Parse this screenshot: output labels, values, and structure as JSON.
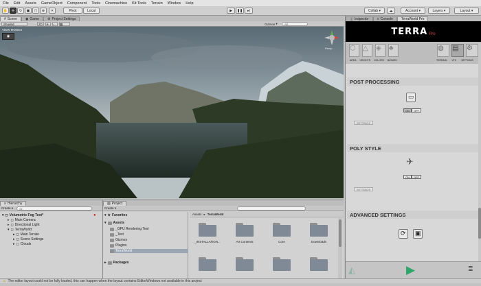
{
  "menu": [
    "File",
    "Edit",
    "Assets",
    "GameObject",
    "Component",
    "Tools",
    "Cinemachine",
    "Kit Tools",
    "Terrain",
    "Window",
    "Help"
  ],
  "toolbar": {
    "pivot": "Pivot",
    "local": "Local",
    "collab": "Collab",
    "account": "Account",
    "layers": "Layers",
    "layout": "Layout"
  },
  "scene_tabs": [
    "Scene",
    "Game",
    "Project Settings"
  ],
  "scene_bar": {
    "shading": "Shaded",
    "mode_2d": "2D",
    "gizmos": "Gizmos",
    "search": "All"
  },
  "view_mode": "VIEW MODES",
  "gizmo_label": "Persp",
  "inspector": {
    "tabs": [
      "Inspector",
      "Console",
      "TerraWorld Pro"
    ],
    "logo_text": "TERRA",
    "logo_suffix": "Pro",
    "nav_left": [
      "AREA",
      "HEIGHTS",
      "COLORS",
      "BIOMES"
    ],
    "nav_right": [
      "TERRAIN",
      "VFX",
      "SETTINGS"
    ],
    "post_processing": "POST PROCESSING",
    "poly_style": "POLY STYLE",
    "advanced": "ADVANCED SETTINGS",
    "on": "ON",
    "off": "OFF",
    "settings": "SETTINGS"
  },
  "hierarchy": {
    "tab": "Hierarchy",
    "create": "Create",
    "search": "All",
    "items": [
      {
        "label": "Volumetric Fog Test*",
        "indent": 0,
        "bold": true
      },
      {
        "label": "Main Camera",
        "indent": 1,
        "bold": false
      },
      {
        "label": "Directional Light",
        "indent": 1,
        "bold": false
      },
      {
        "label": "TerraWorld",
        "indent": 1,
        "bold": false
      },
      {
        "label": "Main Terrain",
        "indent": 2,
        "bold": false
      },
      {
        "label": "Scene Settings",
        "indent": 2,
        "bold": false
      },
      {
        "label": "Clouds",
        "indent": 2,
        "bold": false
      }
    ]
  },
  "project": {
    "tab": "Project",
    "create": "Create",
    "favorites": "Favorites",
    "assets": "Assets",
    "packages": "Packages",
    "tree": [
      "_GPU Rendering Test",
      "_Test",
      "Gizmos",
      "Plugins",
      "TerraWorld"
    ],
    "breadcrumb": [
      "Assets",
      "TerraWorld"
    ],
    "folders": [
      "_INSTALLATION...",
      "Art Contents",
      "Core",
      "Downloads"
    ]
  },
  "status": "The editor layout could not be fully loaded, this can happen when the layout contains EditorWindows not available in this project",
  "colors": {
    "inspector_bg": "#d8d8d8",
    "logo_bg": "#000000",
    "play_green": "#2ea66a"
  }
}
